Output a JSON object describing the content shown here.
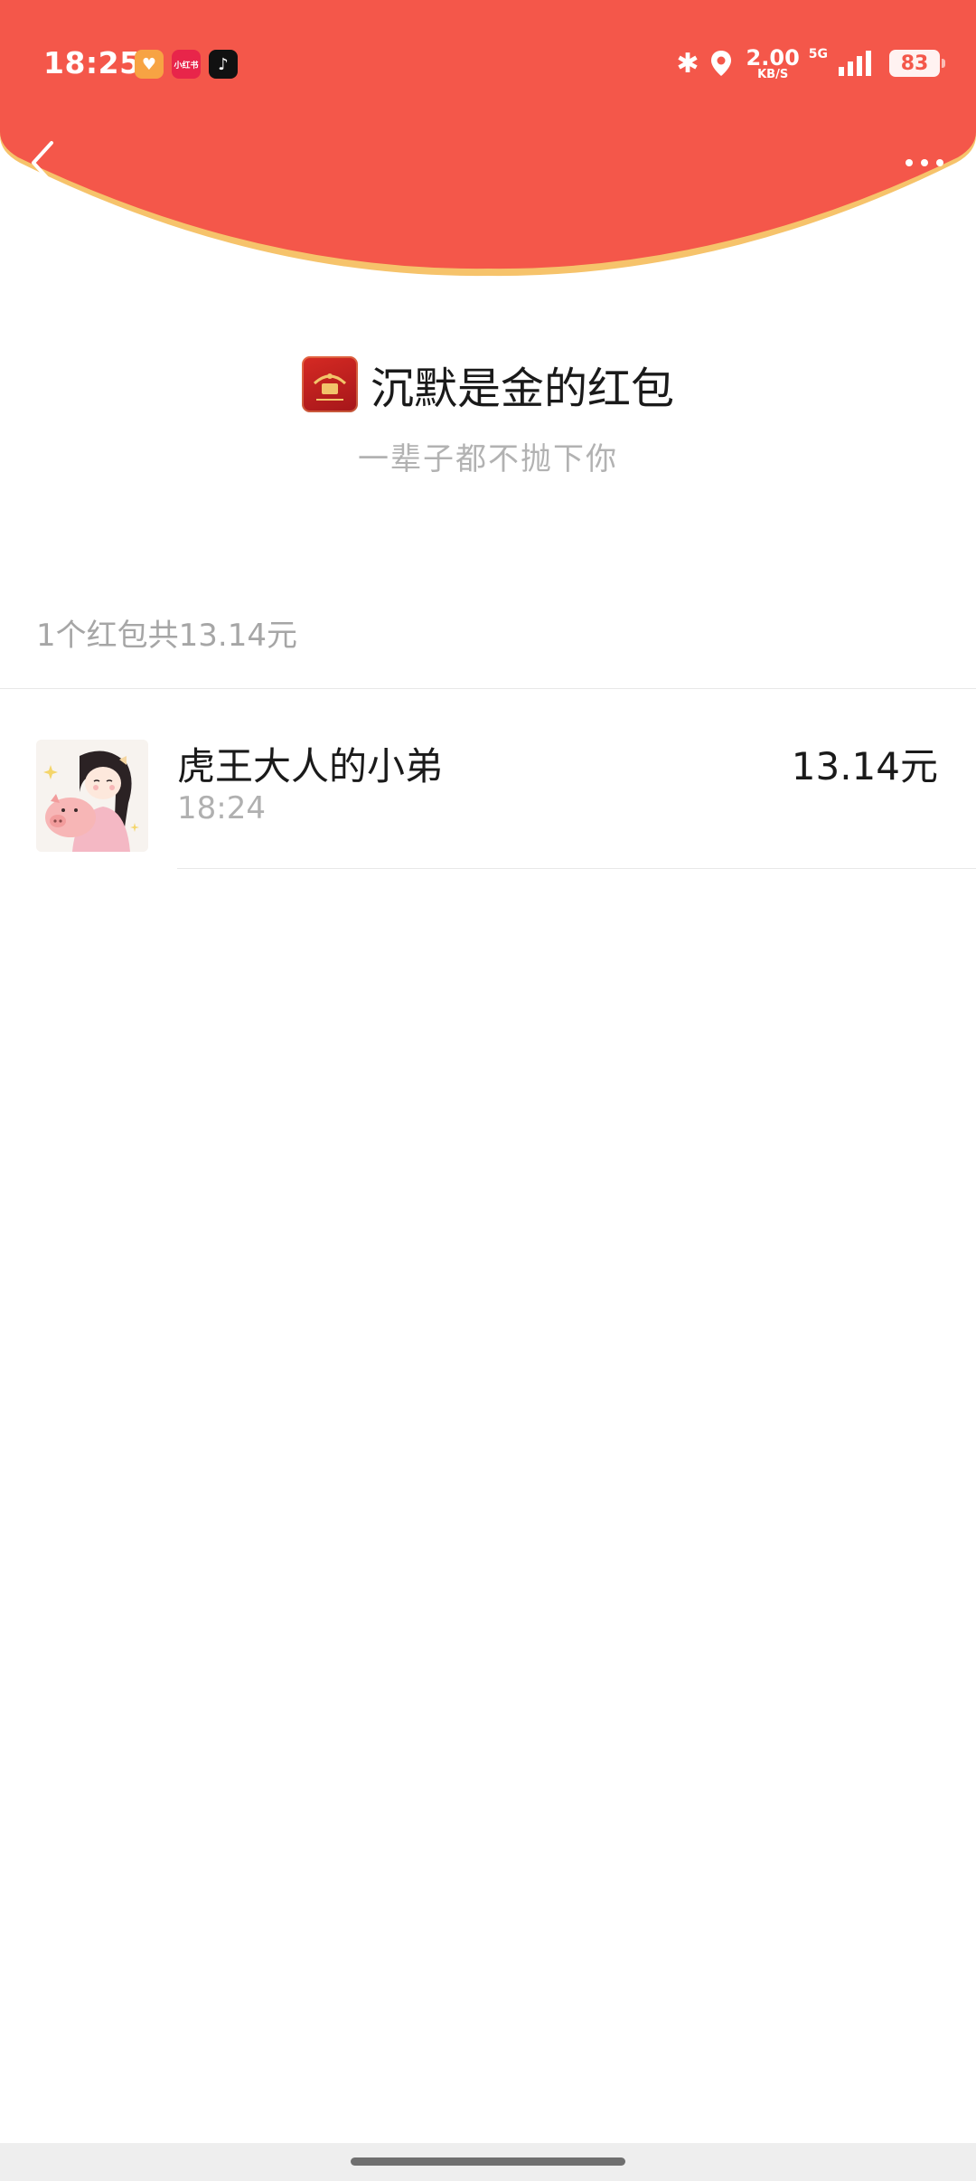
{
  "status_bar": {
    "time": "18:25",
    "app_icons": [
      "heart-app-icon",
      "xiaohongshu-icon",
      "tiktok-icon"
    ],
    "xhs_label": "小红书",
    "net_speed": "2.00",
    "net_speed_unit": "KB/S",
    "network": "5G",
    "battery": "83"
  },
  "header": {
    "color": "#f4574a",
    "edge_color": "#f6c36b",
    "back_icon": "chevron-left-icon",
    "more_icon": "more-dots-icon"
  },
  "packet": {
    "name": "沉默是金的红包",
    "subtitle": "一辈子都不抛下你",
    "logo_icon": "red-packet-cover-icon"
  },
  "summary": "1个红包共13.14元",
  "receivers": [
    {
      "name": "虎王大人的小弟",
      "time": "18:24",
      "amount": "13.14元",
      "avatar": "girl-hugging-pig-avatar"
    }
  ]
}
